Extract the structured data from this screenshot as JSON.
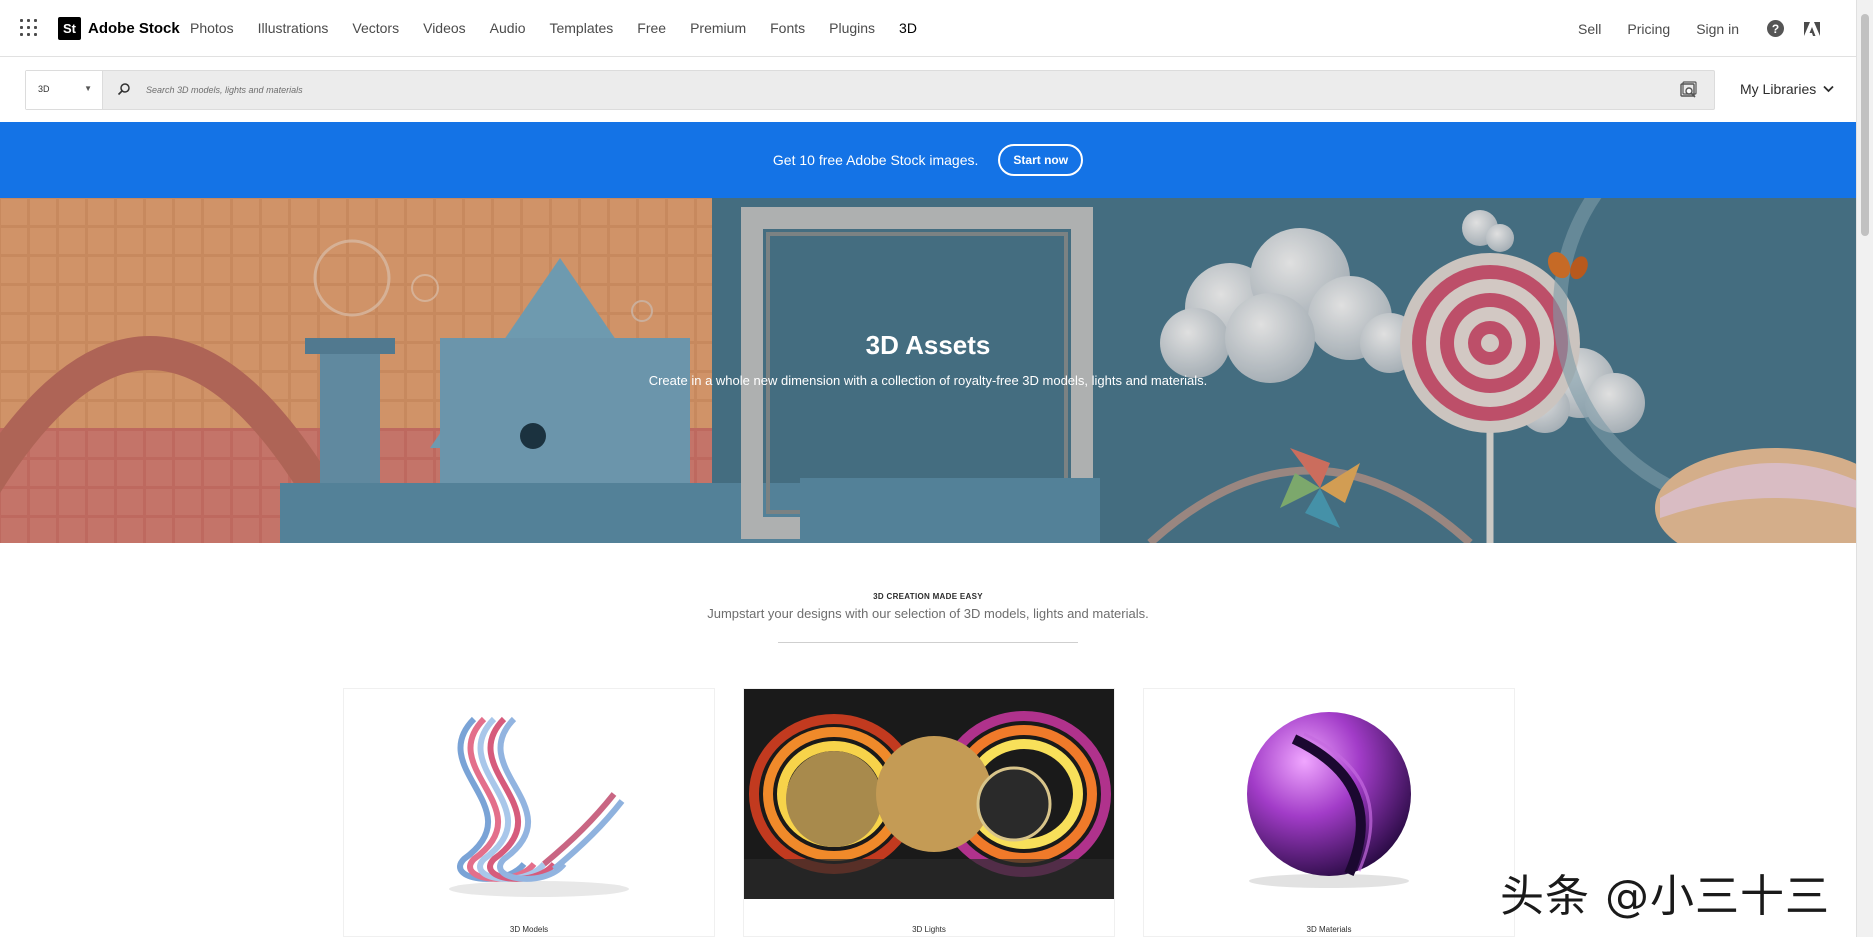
{
  "brand": {
    "logo": "St",
    "name": "Adobe Stock"
  },
  "nav": {
    "links": [
      "Photos",
      "Illustrations",
      "Vectors",
      "Videos",
      "Audio",
      "Templates",
      "Free",
      "Premium",
      "Fonts",
      "Plugins",
      "3D"
    ],
    "right": [
      "Sell",
      "Pricing",
      "Sign in"
    ],
    "help_glyph": "?"
  },
  "search": {
    "type": "3D",
    "placeholder": "Search 3D models, lights and materials",
    "libraries_label": "My Libraries"
  },
  "promo": {
    "text": "Get 10 free Adobe Stock images.",
    "button": "Start now"
  },
  "hero": {
    "title": "3D Assets",
    "subtitle": "Create in a whole new dimension with a collection of royalty-free 3D models, lights and materials."
  },
  "intro": {
    "eyebrow": "3D CREATION MADE EASY",
    "text": "Jumpstart your designs with our selection of 3D models, lights and materials."
  },
  "cards": [
    {
      "label": "3D Models"
    },
    {
      "label": "3D Lights"
    },
    {
      "label": "3D Materials"
    }
  ],
  "watermark": "头条 @小三十三",
  "colors": {
    "accent": "#1473e6",
    "text": "#2c2c2c",
    "muted": "#6e6e6e"
  }
}
